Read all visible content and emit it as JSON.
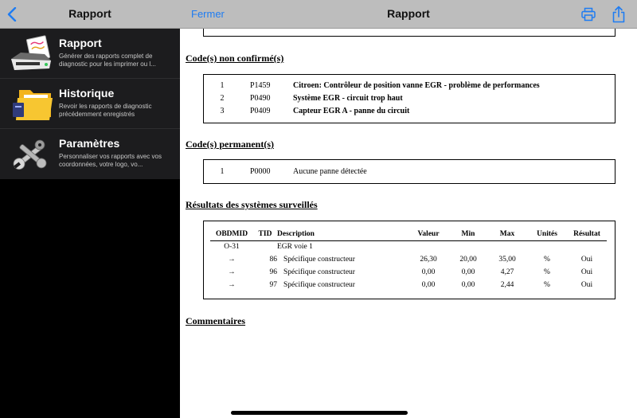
{
  "sidebar": {
    "title": "Rapport",
    "items": [
      {
        "icon": "report-printer-icon",
        "title": "Rapport",
        "desc": "Générer des rapports complet de diagnostic pour les imprimer ou l..."
      },
      {
        "icon": "folder-icon",
        "title": "Historique",
        "desc": "Revoir les rapports de diagnostic précédemment enregistrés"
      },
      {
        "icon": "tools-icon",
        "title": "Paramètres",
        "desc": "Personnaliser vos rapports avec vos coordonnées, votre logo, vo..."
      }
    ]
  },
  "header": {
    "close_label": "Fermer",
    "title": "Rapport",
    "print_icon": "printer-icon",
    "share_icon": "share-icon"
  },
  "colors": {
    "accent": "#1e7cf2",
    "bar": "#bdbdbd",
    "sidebar_bg": "#1c1c1e"
  },
  "report": {
    "unconfirmed": {
      "heading": "Code(s) non confirmé(s)",
      "rows": [
        {
          "n": "1",
          "code": "P1459",
          "desc": "Citroen: Contrôleur de position vanne EGR - problème de performances"
        },
        {
          "n": "2",
          "code": "P0490",
          "desc": "Système EGR - circuit trop haut"
        },
        {
          "n": "3",
          "code": "P0409",
          "desc": "Capteur EGR A - panne du circuit"
        }
      ]
    },
    "permanent": {
      "heading": "Code(s) permanent(s)",
      "rows": [
        {
          "n": "1",
          "code": "P0000",
          "desc": "Aucune panne détectée"
        }
      ]
    },
    "monitored": {
      "heading": "Résultats des systèmes surveillés",
      "columns": [
        "OBDMID",
        "TID",
        "Description",
        "Valeur",
        "Min",
        "Max",
        "Unités",
        "Résultat"
      ],
      "rows": [
        [
          "O-31",
          "",
          "EGR voie 1",
          "",
          "",
          "",
          "",
          ""
        ],
        [
          "→",
          "86",
          "Spécifique constructeur",
          "26,30",
          "20,00",
          "35,00",
          "%",
          "Oui"
        ],
        [
          "→",
          "96",
          "Spécifique constructeur",
          "0,00",
          "0,00",
          "4,27",
          "%",
          "Oui"
        ],
        [
          "→",
          "97",
          "Spécifique constructeur",
          "0,00",
          "0,00",
          "2,44",
          "%",
          "Oui"
        ]
      ]
    },
    "comments": {
      "heading": "Commentaires"
    }
  }
}
